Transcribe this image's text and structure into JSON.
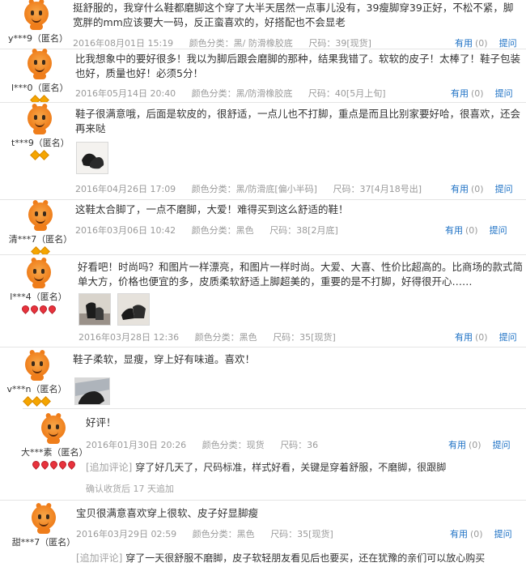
{
  "common": {
    "useful_label": "有用",
    "useful_count": "(0)",
    "ask_label": "提问",
    "addon_label": "[追加评论]"
  },
  "reviews": [
    {
      "user": "y***9（匿名）",
      "text": "挺舒服的，我穿什么鞋都磨脚这个穿了大半天居然一点事儿没有，39瘦脚穿39正好，不松不紧，脚宽胖的mm应该要大一码，反正蛮喜欢的，好搭配也不会显老",
      "date": "2016年08月01日 15:19",
      "color": "颜色分类：黑/ 防滑橡胶底",
      "size": "尺码：39[现货]"
    },
    {
      "user": "l***0（匿名）",
      "text": "比我想象中的要好很多！我以为脚后跟会磨脚的那种，结果我错了。软软的皮子！太棒了！鞋子包装也好，质量也好！必须5分！",
      "date": "2016年05月14日 20:40",
      "color": "颜色分类：黑/防滑橡胶底",
      "size": "尺码：40[5月上旬]"
    },
    {
      "user": "t***9（匿名）",
      "text": "鞋子很满意哦，后面是软皮的，很舒适，一点儿也不打脚，重点是而且比别家要好哈，很喜欢，还会再来哒",
      "date": "2016年04月26日 17:09",
      "color": "颜色分类：黑/防滑底[偏小半码]",
      "size": "尺码：37[4月18号出]"
    },
    {
      "user": "清***7（匿名）",
      "text": "这鞋太合脚了，一点不磨脚，大爱！难得买到这么舒适的鞋！",
      "date": "2016年03月06日 10:42",
      "color": "颜色分类：黑色",
      "size": "尺码：38[2月底]"
    },
    {
      "user": "l***4（匿名）",
      "text": "好看吧！时尚吗？和图片一样漂亮，和图片一样时尚。大爱、大喜、性价比超高的。比商场的款式简单大方，价格也便宜的多，皮质柔软舒适上脚超美的，重要的是不打脚，好得很开心……",
      "date": "2016年03月28日 12:36",
      "color": "颜色分类：黑色",
      "size": "尺码：35[现货]"
    },
    {
      "user": "v***n（匿名）",
      "text": "鞋子柔软，显瘦，穿上好有味道。喜欢！"
    },
    {
      "user": "大***素（匿名）",
      "text": "好评！",
      "date": "2016年01月30日 20:26",
      "color": "颜色分类：现货",
      "size": "尺码：36",
      "addon": "穿了好几天了，尺码标准，样式好看，关键是穿着舒服，不磨脚，很跟脚",
      "addon_note": "确认收货后 17 天追加"
    },
    {
      "user": "甜***7（匿名）",
      "text": "宝贝很满意喜欢穿上很软、皮子好显脚瘦",
      "date": "2016年03月29日 02:59",
      "color": "颜色分类：黑色",
      "size": "尺码：35[现货]",
      "addon": "穿了一天很舒服不磨脚，皮子软轻朋友看见后也要买，还在犹豫的亲们可以放心购买"
    }
  ]
}
